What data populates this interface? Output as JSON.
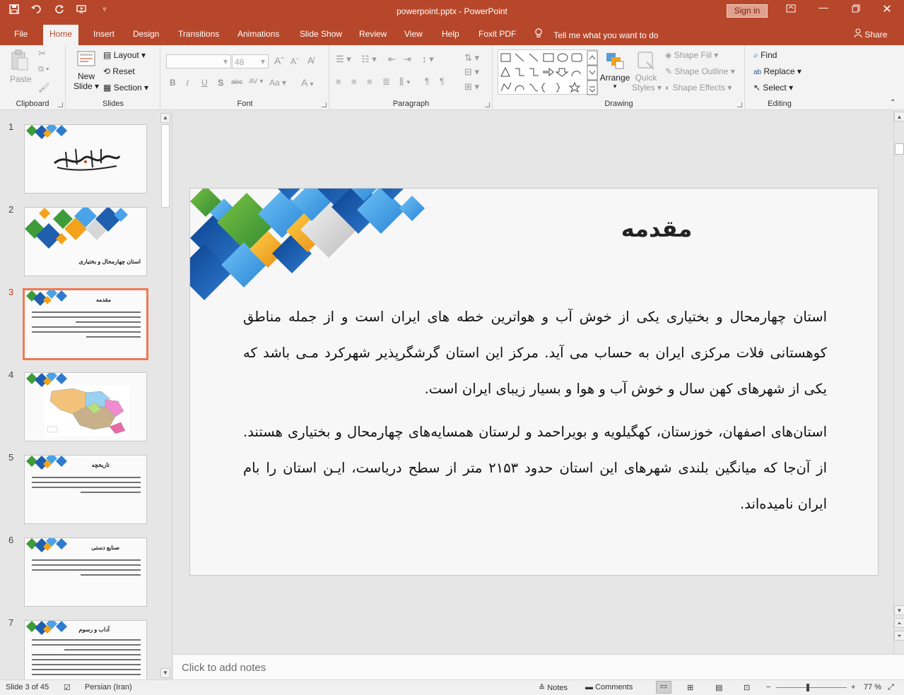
{
  "titlebar": {
    "document_title": "powerpoint.pptx  -  PowerPoint",
    "sign_in": "Sign in",
    "qat_icons": [
      "save-icon",
      "undo-icon",
      "redo-icon",
      "start-from-beginning-icon",
      "customize-qat-icon"
    ],
    "window_buttons": [
      "ribbon-display-icon",
      "minimize-icon",
      "restore-icon",
      "close-icon"
    ]
  },
  "tabs": [
    "File",
    "Home",
    "Insert",
    "Design",
    "Transitions",
    "Animations",
    "Slide Show",
    "Review",
    "View",
    "Help",
    "Foxit PDF"
  ],
  "active_tab": "Home",
  "tell_me": "Tell me what you want to do",
  "share": "Share",
  "ribbon": {
    "clipboard": {
      "label": "Clipboard",
      "paste": "Paste"
    },
    "slides": {
      "label": "Slides",
      "new_slide_1": "New",
      "new_slide_2": "Slide",
      "layout": "Layout",
      "reset": "Reset",
      "section": "Section"
    },
    "font": {
      "label": "Font",
      "size": "48",
      "bold": "B",
      "italic": "I",
      "underline": "U",
      "shadow": "S",
      "strike": "abc",
      "spacing": "AV",
      "case": "Aa",
      "color": "A",
      "grow": "A",
      "shrink": "A"
    },
    "paragraph": {
      "label": "Paragraph"
    },
    "drawing": {
      "label": "Drawing",
      "arrange": "Arrange",
      "quick_1": "Quick",
      "quick_2": "Styles",
      "shape_fill": "Shape Fill",
      "shape_outline": "Shape Outline",
      "shape_effects": "Shape Effects"
    },
    "editing": {
      "label": "Editing",
      "find": "Find",
      "replace": "Replace",
      "select": "Select"
    }
  },
  "thumbnails": [
    {
      "num": "1",
      "title": ""
    },
    {
      "num": "2",
      "title": "استان چهارمحال و بختیاری"
    },
    {
      "num": "3",
      "title": "مقدمه"
    },
    {
      "num": "4",
      "title": ""
    },
    {
      "num": "5",
      "title": "تاریخچه"
    },
    {
      "num": "6",
      "title": "صنایع دستی"
    },
    {
      "num": "7",
      "title": "آداب و رسوم"
    }
  ],
  "current_slide": 3,
  "slide": {
    "title": "مقدمه",
    "paragraph_1": "استان چهارمحال و بختیاری یکی از خوش آب و هواترین خطه های ایران است و از جمله مناطق کوهستانی فلات مرکزی ایران به حساب می آید. مرکز این استان گرشگرپذیر شهرکرد مـی باشد که یکی از شهرهای کهن سال و خوش آب و هوا و بسیار زیبای ایران است.",
    "paragraph_2": "استان‌های اصفهان، خوزستان، کهگیلویه و بویراحمد و لرستان همسایه‌های چهارمحال و بختیاری هستند. از آن‌جا که میانگین بلندی شهرهای این استان حدود ۲۱۵۳ متر از سطح دریاست، ایـن استان را بام ایران نامیده‌اند."
  },
  "notes_placeholder": "Click to add notes",
  "status": {
    "slide_info": "Slide 3 of 45",
    "language": "Persian (Iran)",
    "notes": "Notes",
    "comments": "Comments",
    "zoom": "77 %",
    "zoom_level": 0.45
  },
  "colors": {
    "accent": "#b7472a",
    "selection": "#ef7954",
    "diamond_blue": "#1f5fae",
    "diamond_green": "#3f9b3a",
    "diamond_orange": "#f3a21a"
  }
}
